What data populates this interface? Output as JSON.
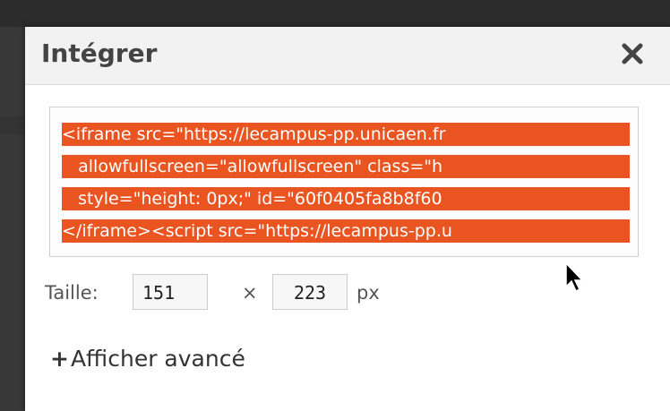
{
  "dialog": {
    "title": "Intégrer",
    "close_icon": "close-icon"
  },
  "embed_code": {
    "lines": [
      "<iframe src=\"https://lecampus-pp.unicaen.fr",
      "   allowfullscreen=\"allowfullscreen\" class=\"h",
      "   style=\"height: 0px;\" id=\"60f0405fa8b8f60",
      "</iframe><script src=\"https://lecampus-pp.u"
    ],
    "highlight_color": "#e95420"
  },
  "size": {
    "label": "Taille:",
    "width_value": "151",
    "times": "×",
    "height_value": "223",
    "unit": "px"
  },
  "advanced": {
    "plus": "+",
    "label": "Afficher avancé"
  }
}
